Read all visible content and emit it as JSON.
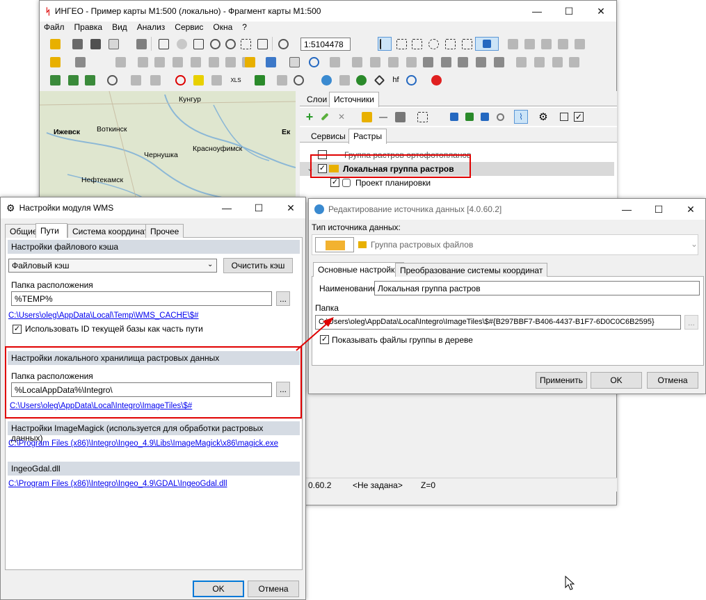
{
  "main": {
    "title": "ИНГЕО - Пример карты М1:500 (локально) - Фрагмент карты М1:500",
    "menu": [
      "Файл",
      "Правка",
      "Вид",
      "Анализ",
      "Сервис",
      "Окна",
      "?"
    ],
    "scale_value": "1:5104478",
    "map_labels": [
      "Кунгур",
      "Ижевск",
      "Воткинск",
      "Чернушка",
      "Красноуфимск",
      "Ек",
      "Нефтекамск"
    ],
    "panel_tabs": [
      "Слои",
      "Источники"
    ],
    "sub_tabs": [
      "Сервисы",
      "Растры"
    ],
    "tree": {
      "item1": "Группа растров ортофотопланов",
      "item2": "Локальная группа растров",
      "item3": "Проект планировки"
    },
    "status": {
      "version": "0.60.2",
      "cs": "<Не задана>",
      "z": "Z=0"
    }
  },
  "wms": {
    "title": "Настройки модуля WMS",
    "tabs": [
      "Общие",
      "Пути",
      "Система координат",
      "Прочее"
    ],
    "cache_section": "Настройки файлового кэша",
    "cache_type": "Файловый кэш",
    "clear_cache": "Очистить кэш",
    "folder_label": "Папка расположения",
    "folder_value": "%TEMP%",
    "browse": "...",
    "cache_path": "C:\\Users\\oleg\\AppData\\Local\\Temp\\WMS_CACHE\\$#",
    "use_db_id": "Использовать ID текущей базы как часть пути",
    "raster_section": "Настройки локального хранилища растровых данных",
    "raster_folder_label": "Папка расположения",
    "raster_folder_value": "%LocalAppData%\\Integro\\",
    "raster_path": "C:\\Users\\oleg\\AppData\\Local\\Integro\\ImageTiles\\$#",
    "imagick_section": "Настройки ImageMagick (используется для обработки растровых данных)",
    "imagick_path": "C:\\Program Files (x86)\\Integro\\Ingeo_4.9\\Libs\\ImageMagick\\x86\\magick.exe",
    "gdal_section": "IngeoGdal.dll",
    "gdal_path": "C:\\Program Files (x86)\\Integro\\Ingeo_4.9\\GDAL\\IngeoGdal.dll",
    "ok": "OK",
    "cancel": "Отмена"
  },
  "edit": {
    "title": "Редактирование источника данных [4.0.60.2]",
    "type_label": "Тип источника данных:",
    "type_value": "Группа растровых файлов",
    "tabs": [
      "Основные настройки",
      "Преобразование системы координат"
    ],
    "name_label": "Наименование",
    "name_value": "Локальная группа растров",
    "folder_label": "Папка",
    "folder_value": "C:\\Users\\oleg\\AppData\\Local\\Integro\\ImageTiles\\$#{B297BBF7-B406-4437-B1F7-6D0C0C6B2595}",
    "browse": "...",
    "show_files": "Показывать файлы группы в дереве",
    "apply": "Применить",
    "ok": "OK",
    "cancel": "Отмена"
  },
  "colors": {
    "highlight": "#e00000",
    "link": "#0000ee",
    "section": "#d5dbe3"
  }
}
